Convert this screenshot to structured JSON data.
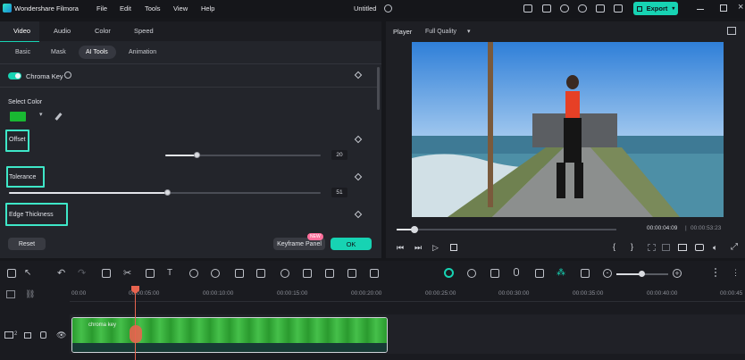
{
  "app": {
    "name": "Wondershare Filmora",
    "doc_title": "Untitled",
    "export_label": "Export"
  },
  "menu": [
    "File",
    "Edit",
    "Tools",
    "View",
    "Help"
  ],
  "tabs": [
    "Video",
    "Audio",
    "Color",
    "Speed"
  ],
  "subtabs": [
    "Basic",
    "Mask",
    "AI Tools",
    "Animation"
  ],
  "chroma": {
    "title": "Chroma Key",
    "select_color_label": "Select Color",
    "swatch_color": "#19b832",
    "offset_label": "Offset",
    "offset_value": "20",
    "offset_fraction": 0.2,
    "tolerance_label": "Tolerance",
    "tolerance_value": "51",
    "tolerance_fraction": 0.51,
    "edge_label": "Edge Thickness"
  },
  "buttons": {
    "reset": "Reset",
    "keyframe": "Keyframe Panel",
    "new_badge": "NEW",
    "ok": "OK"
  },
  "player": {
    "label": "Player",
    "quality": "Full Quality",
    "current_time": "00:00:04:09",
    "total_time": "00:00:53:23",
    "progress": 0.08
  },
  "timeline": {
    "ruler": [
      "00:00",
      "00:00:05:00",
      "00:00:10:00",
      "00:00:15:00",
      "00:00:20:00",
      "00:00:25:00",
      "00:00:30:00",
      "00:00:35:00",
      "00:00:40:00",
      "00:00:45"
    ],
    "clip_name": "chroma key",
    "track_number": "2"
  },
  "colors": {
    "accent": "#17d3b3",
    "highlight": "#3ee7c8",
    "playhead": "#e8644f"
  }
}
